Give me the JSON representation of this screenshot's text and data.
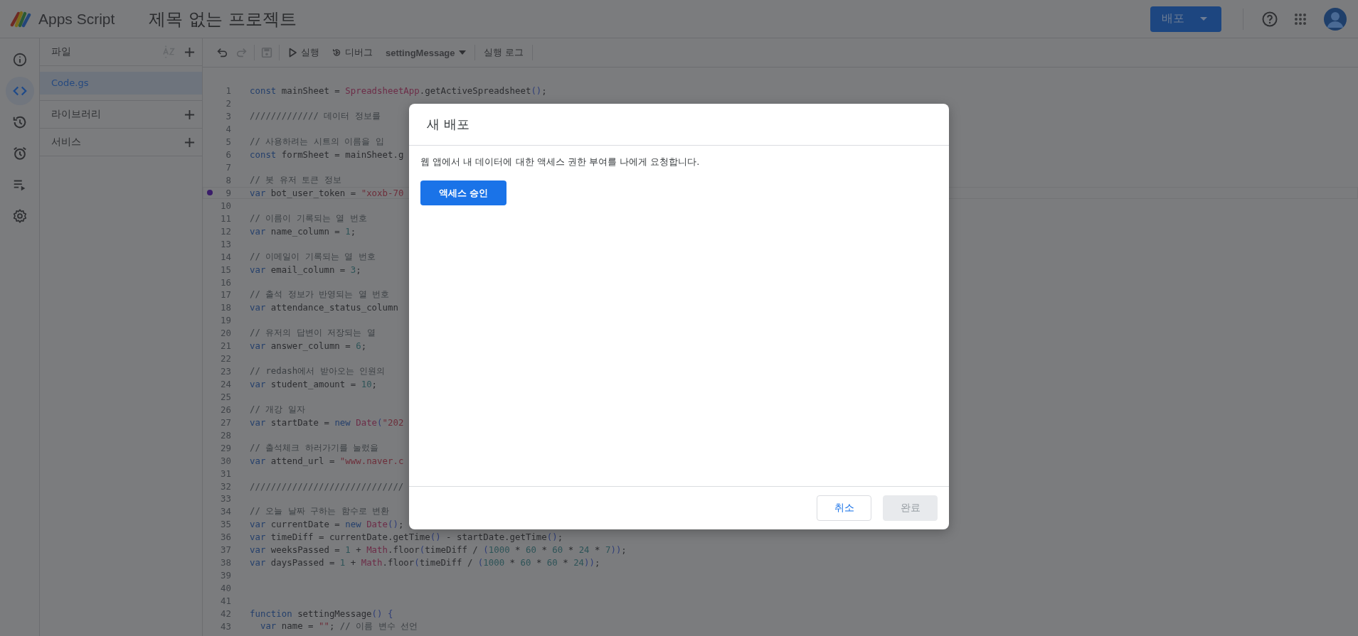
{
  "app": {
    "name": "Apps Script"
  },
  "project_title": "제목 없는 프로젝트",
  "deploy_button": {
    "label": "배포"
  },
  "rail": [
    {
      "kind": "info",
      "selected": false
    },
    {
      "kind": "code",
      "selected": true
    },
    {
      "kind": "history",
      "selected": false
    },
    {
      "kind": "triggers",
      "selected": false
    },
    {
      "kind": "executions",
      "selected": false
    },
    {
      "kind": "settings",
      "selected": false
    }
  ],
  "files_panel": {
    "title": "파일",
    "files": [
      {
        "name": "Code.gs",
        "selected": true
      }
    ],
    "sections": [
      {
        "label": "라이브러리"
      },
      {
        "label": "서비스"
      }
    ]
  },
  "toolbar": {
    "groups": [
      {
        "items": [
          {
            "kind": "undo",
            "disabled": false
          },
          {
            "kind": "redo",
            "disabled": true
          }
        ]
      },
      {
        "items": [
          {
            "kind": "save",
            "disabled": true
          }
        ]
      },
      {
        "items": [
          {
            "kind": "run",
            "label": "실행"
          },
          {
            "kind": "debug",
            "label": "디버그"
          },
          {
            "kind": "function",
            "label": "settingMessage"
          }
        ]
      },
      {
        "items": [
          {
            "kind": "log",
            "label": "실행 로그"
          }
        ]
      }
    ]
  },
  "editor": {
    "lines": [
      {
        "number": "1",
        "text": "const mainSheet = SpreadsheetApp.getActiveSpreadsheet();",
        "breakpoint": false
      },
      {
        "number": "2",
        "breakpoint": false
      },
      {
        "number": "3",
        "text": "///////////// 데이터 정보를",
        "breakpoint": false
      },
      {
        "number": "4",
        "breakpoint": false
      },
      {
        "number": "5",
        "text": "// 사용하려는 시트의 이름을 입",
        "breakpoint": false
      },
      {
        "number": "6",
        "text": "const formSheet = mainSheet.g",
        "breakpoint": false
      },
      {
        "number": "7",
        "breakpoint": false
      },
      {
        "number": "8",
        "text": "// 봇 유저 토큰 정보",
        "breakpoint": false
      },
      {
        "number": "9",
        "text": "var bot_user_token = \"xoxb-70",
        "breakpoint": true
      },
      {
        "number": "10",
        "breakpoint": false
      },
      {
        "number": "11",
        "text": "// 이름이 기록되는 열 번호",
        "breakpoint": false
      },
      {
        "number": "12",
        "text": "var name_column = 1;",
        "breakpoint": false
      },
      {
        "number": "13",
        "breakpoint": false
      },
      {
        "number": "14",
        "text": "// 이메일이 기록되는 열 번호",
        "breakpoint": false
      },
      {
        "number": "15",
        "text": "var email_column = 3;",
        "breakpoint": false
      },
      {
        "number": "16",
        "breakpoint": false
      },
      {
        "number": "17",
        "text": "// 출석 정보가 반영되는 열 번호",
        "breakpoint": false
      },
      {
        "number": "18",
        "text": "var attendance_status_column",
        "breakpoint": false
      },
      {
        "number": "19",
        "breakpoint": false
      },
      {
        "number": "20",
        "text": "// 유저의 답변이 저장되는 열",
        "breakpoint": false
      },
      {
        "number": "21",
        "text": "var answer_column = 6;",
        "breakpoint": false
      },
      {
        "number": "22",
        "breakpoint": false
      },
      {
        "number": "23",
        "text": "// redash에서 받아오는 인원의",
        "breakpoint": false
      },
      {
        "number": "24",
        "text": "var student_amount = 10;",
        "breakpoint": false
      },
      {
        "number": "25",
        "breakpoint": false
      },
      {
        "number": "26",
        "text": "// 개강 일자",
        "breakpoint": false
      },
      {
        "number": "27",
        "text": "var startDate = new Date(\"202",
        "breakpoint": false
      },
      {
        "number": "28",
        "breakpoint": false
      },
      {
        "number": "29",
        "text": "// 출석체크 하러가기를 눌렀을",
        "breakpoint": false
      },
      {
        "number": "30",
        "text": "var attend_url = \"www.naver.c",
        "breakpoint": false
      },
      {
        "number": "31",
        "breakpoint": false
      },
      {
        "number": "32",
        "text": "/////////////////////////////",
        "breakpoint": false
      },
      {
        "number": "33",
        "breakpoint": false
      },
      {
        "number": "34",
        "text": "// 오늘 날짜 구하는 함수로 변환",
        "breakpoint": false
      },
      {
        "number": "35",
        "text": "var currentDate = new Date();",
        "breakpoint": false
      },
      {
        "number": "36",
        "text": "var timeDiff = currentDate.getTime() - startDate.getTime();",
        "breakpoint": false
      },
      {
        "number": "37",
        "text": "var weeksPassed = 1 + Math.floor(timeDiff / (1000 * 60 * 60 * 24 * 7));",
        "breakpoint": false
      },
      {
        "number": "38",
        "text": "var daysPassed = 1 + Math.floor(timeDiff / (1000 * 60 * 60 * 24));",
        "breakpoint": false
      },
      {
        "number": "39",
        "breakpoint": false
      },
      {
        "number": "40",
        "breakpoint": false
      },
      {
        "number": "41",
        "breakpoint": false
      },
      {
        "number": "42",
        "text": "function settingMessage() {",
        "breakpoint": false
      },
      {
        "number": "43",
        "text": "  var name = \"\"; // 이름 변수 선언",
        "breakpoint": false
      }
    ]
  },
  "dialog": {
    "title": "새 배포",
    "message": "웹 앱에서 내 데이터에 대한 액세스 권한 부여를 나에게 요청합니다.",
    "authorize_button": "액세스 승인",
    "buttons": [
      {
        "label": "취소",
        "disabled": false
      },
      {
        "label": "완료",
        "disabled": true
      }
    ]
  }
}
